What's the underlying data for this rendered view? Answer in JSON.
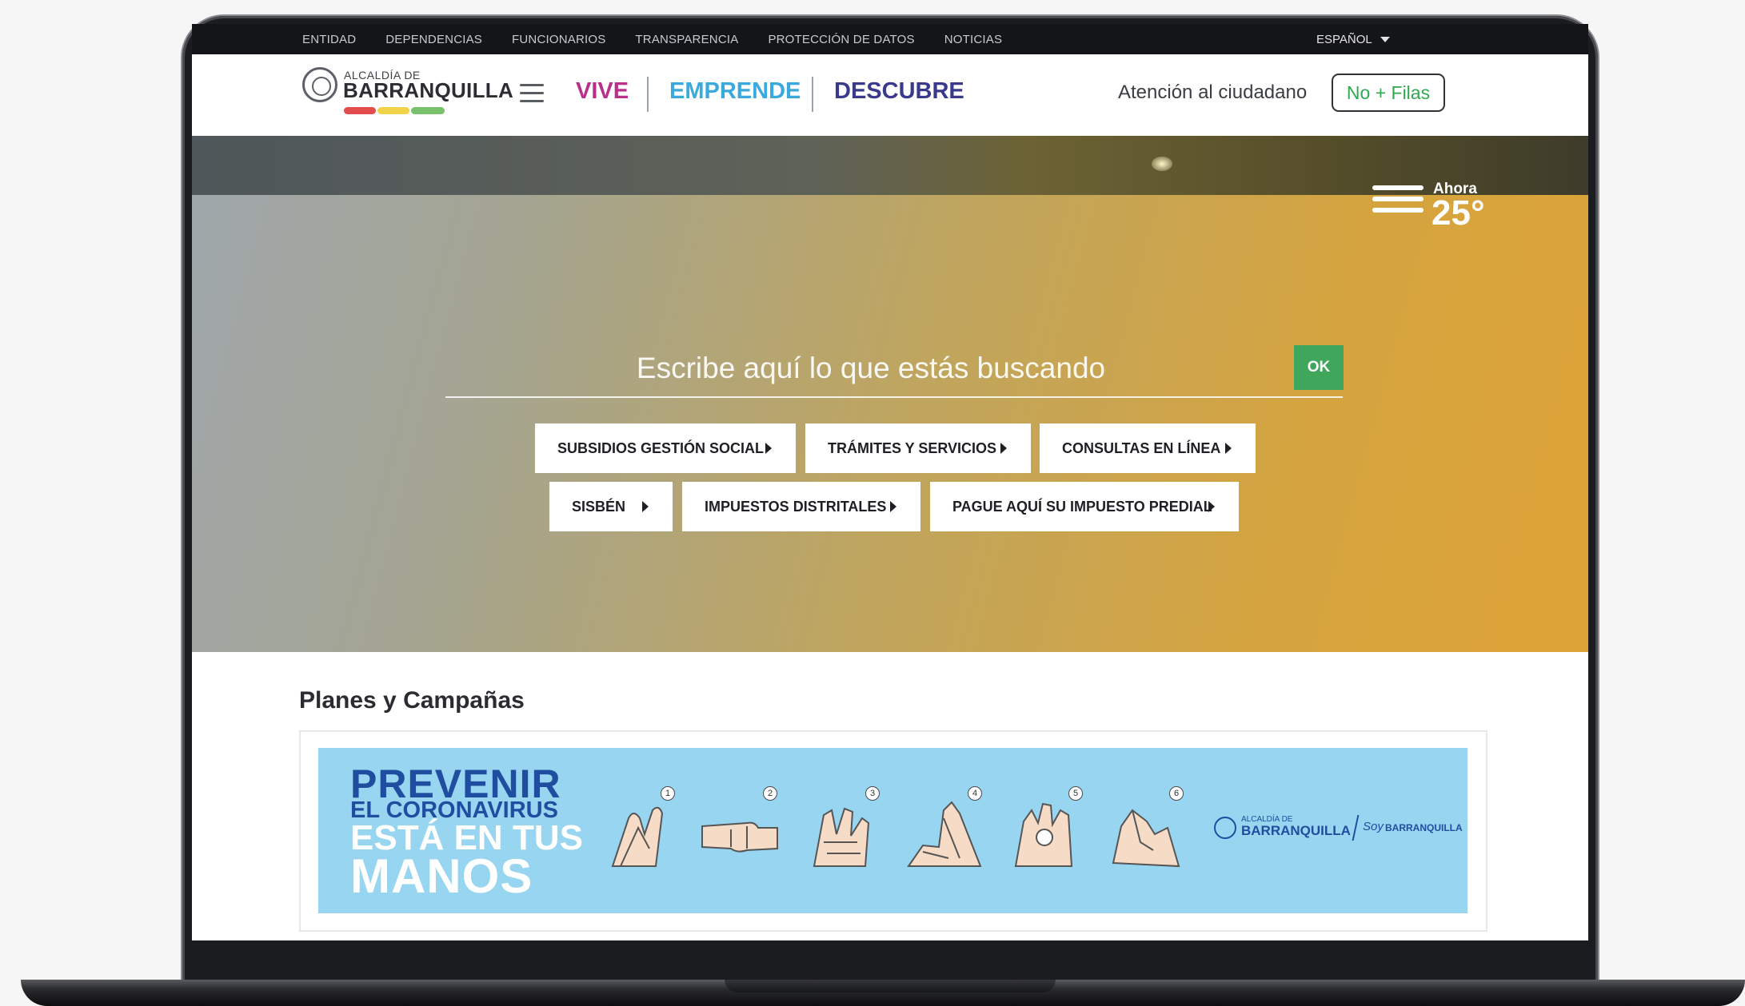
{
  "topbar": {
    "links": [
      "ENTIDAD",
      "DEPENDENCIAS",
      "FUNCIONARIOS",
      "TRANSPARENCIA",
      "PROTECCIÓN DE DATOS",
      "NOTICIAS"
    ],
    "language": "ESPAÑOL"
  },
  "header": {
    "logo_line1": "ALCALDÍA DE",
    "logo_line2": "BARRANQUILLA",
    "nav": {
      "vive": "VIVE",
      "emprende": "EMPRENDE",
      "descubre": "DESCUBRE"
    },
    "attention": "Atención al ciudadano",
    "no_filas": "No + Filas"
  },
  "weather": {
    "label": "Ahora",
    "temperature": "25°"
  },
  "search": {
    "placeholder": "Escribe aquí lo que estás buscando",
    "button": "OK"
  },
  "quick_links": [
    "SUBSIDIOS GESTIÓN SOCIAL",
    "TRÁMITES Y SERVICIOS",
    "CONSULTAS EN LÍNEA",
    "SISBÉN",
    "IMPUESTOS DISTRITALES",
    "PAGUE AQUÍ SU IMPUESTO PREDIAL"
  ],
  "campaigns": {
    "title": "Planes y Campañas",
    "banner": {
      "line1": "PREVENIR",
      "line2": "EL CORONAVIRUS",
      "line3": "ESTÁ EN TUS",
      "line4": "MANOS",
      "steps": [
        "1",
        "2",
        "3",
        "4",
        "5",
        "6"
      ],
      "logo_line1": "ALCALDÍA DE",
      "logo_line2": "BARRANQUILLA",
      "logo_soy": "Soy",
      "logo_soy_city": "BARRANQUILLA"
    }
  },
  "colors": {
    "vive": "#b8308a",
    "emprende": "#39a9de",
    "descubre": "#3a3a8c",
    "ok_button": "#3fa65c",
    "no_filas_text": "#2fa84f",
    "hero_gradient_start": "#a0a7ab",
    "hero_gradient_end": "#dea337",
    "banner_bg": "#98d5f1"
  }
}
